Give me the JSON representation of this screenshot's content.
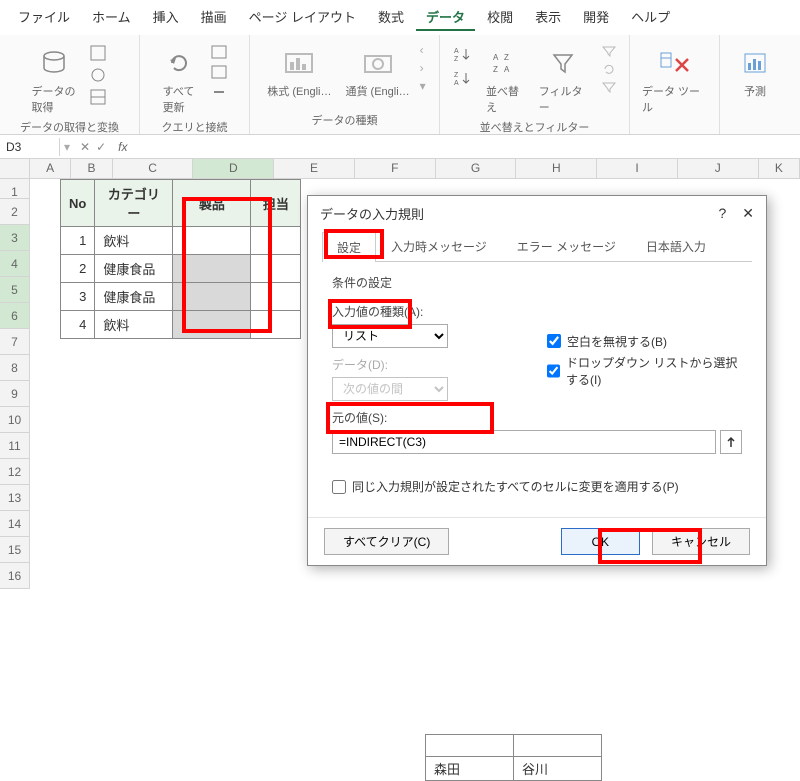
{
  "menu": {
    "items": [
      "ファイル",
      "ホーム",
      "挿入",
      "描画",
      "ページ レイアウト",
      "数式",
      "データ",
      "校閲",
      "表示",
      "開発",
      "ヘルプ"
    ],
    "active": 6
  },
  "ribbon": {
    "group1": {
      "label": "データの取得と変換",
      "get": "データの\n取得"
    },
    "group2": {
      "label": "クエリと接続",
      "refresh": "すべて\n更新"
    },
    "group3": {
      "label": "データの種類",
      "stock": "株式 (Engli…",
      "currency": "通貨 (Engli…"
    },
    "group4": {
      "label": "並べ替えとフィルター",
      "sort": "並べ替え",
      "filter": "フィルター"
    },
    "group5": {
      "tools": "データ ツール"
    },
    "group6": {
      "forecast": "予測"
    }
  },
  "namebox": "D3",
  "columns": [
    "A",
    "B",
    "C",
    "D",
    "E",
    "F",
    "G",
    "H",
    "I",
    "J",
    "K"
  ],
  "table": {
    "headers": [
      "No",
      "カテゴリー",
      "製品",
      "担当"
    ],
    "rows": [
      {
        "no": "1",
        "cat": "飲料"
      },
      {
        "no": "2",
        "cat": "健康食品"
      },
      {
        "no": "3",
        "cat": "健康食品"
      },
      {
        "no": "4",
        "cat": "飲料"
      }
    ]
  },
  "bottom": {
    "r1": [
      "",
      ""
    ],
    "r2": [
      "森田",
      "谷川"
    ]
  },
  "dialog": {
    "title": "データの入力規則",
    "tabs": [
      "設定",
      "入力時メッセージ",
      "エラー メッセージ",
      "日本語入力"
    ],
    "sect": "条件の設定",
    "typeLabel": "入力値の種類(A):",
    "typeValue": "リスト",
    "dataLabel": "データ(D):",
    "dataValue": "次の値の間",
    "cb1": "空白を無視する(B)",
    "cb2": "ドロップダウン リストから選択する(I)",
    "srcLabel": "元の値(S):",
    "srcValue": "=INDIRECT(C3)",
    "apply": "同じ入力規則が設定されたすべてのセルに変更を適用する(P)",
    "clear": "すべてクリア(C)",
    "ok": "OK",
    "cancel": "キャンセル"
  }
}
